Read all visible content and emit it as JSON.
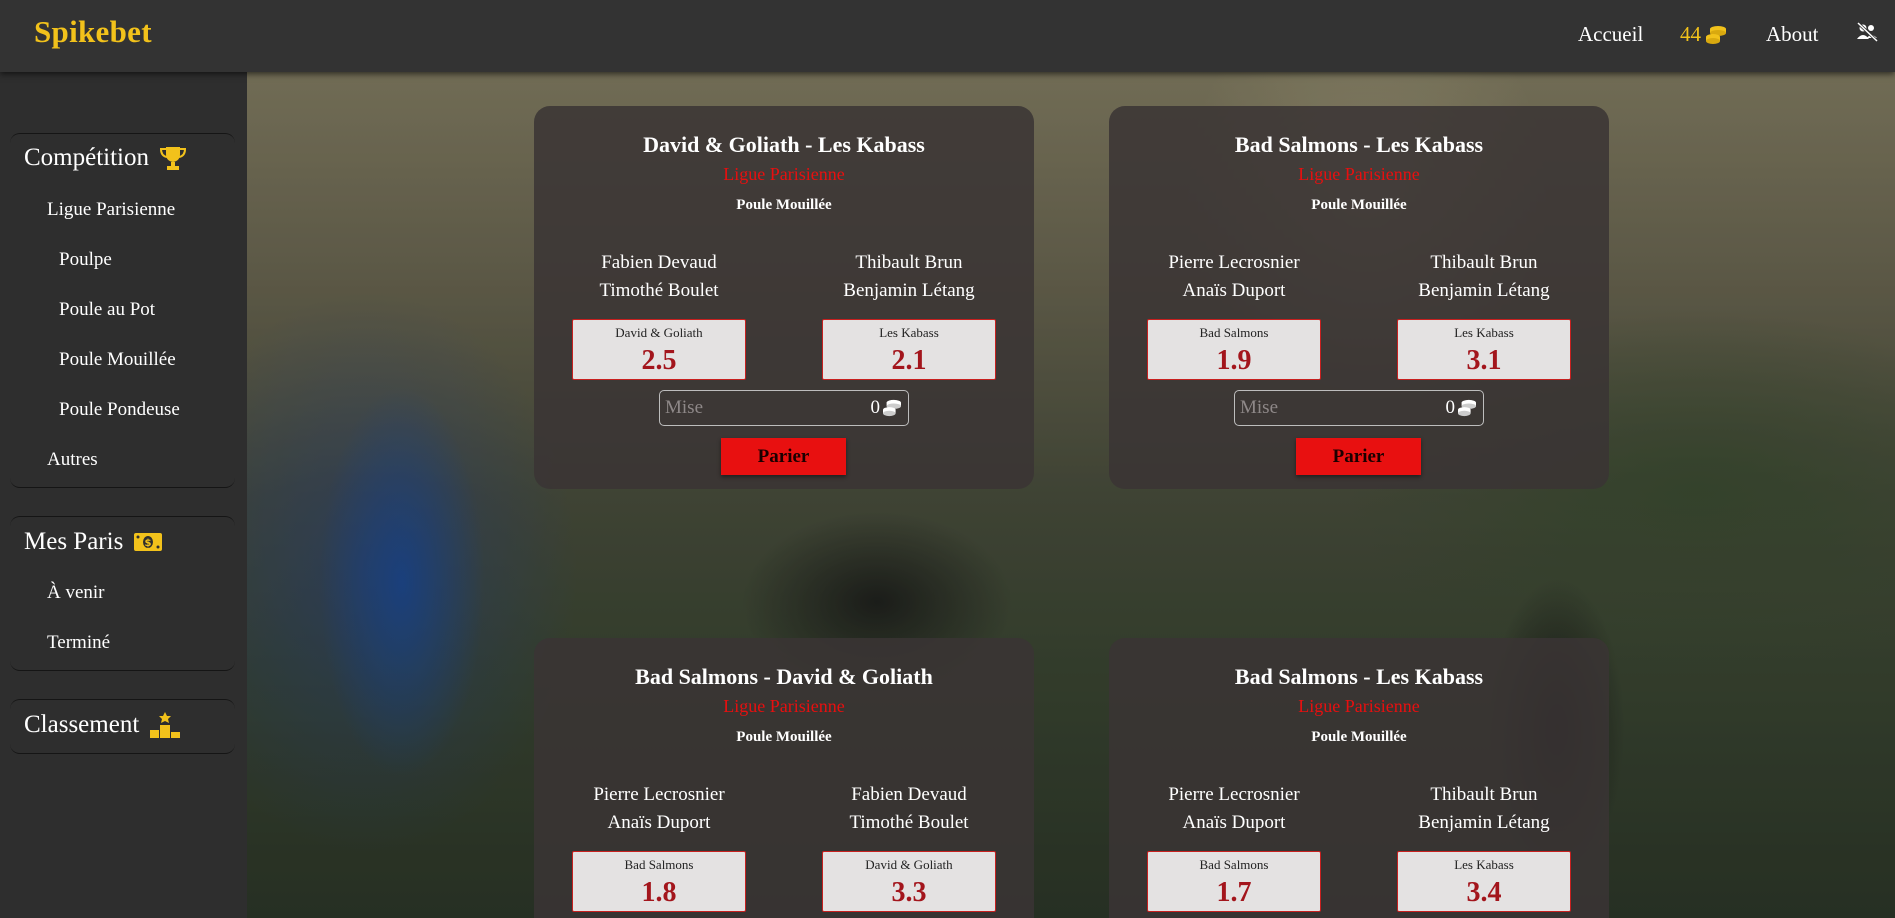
{
  "header": {
    "brand": "Spikebet",
    "nav_home": "Accueil",
    "coins": "44",
    "nav_about": "About",
    "user_icon": "users-slash-icon",
    "coin_icon": "coins-icon"
  },
  "sidebar": {
    "competition": {
      "title": "Compétition",
      "icon": "trophy-icon",
      "league": "Ligue Parisienne",
      "pools": [
        "Poulpe",
        "Poule au Pot",
        "Poule Mouillée",
        "Poule Pondeuse"
      ],
      "other": "Autres"
    },
    "bets": {
      "title": "Mes Paris",
      "icon": "money-bill-icon",
      "upcoming": "À venir",
      "finished": "Terminé"
    },
    "ranking": {
      "title": "Classement",
      "icon": "podium-icon"
    }
  },
  "matches": [
    {
      "title": "David & Goliath - Les Kabass",
      "league": "Ligue Parisienne",
      "pool": "Poule Mouillée",
      "team1_players": [
        "Fabien Devaud",
        "Timothé Boulet"
      ],
      "team2_players": [
        "Thibault Brun",
        "Benjamin Létang"
      ],
      "team1": "David & Goliath",
      "odd1": "2.5",
      "team2": "Les Kabass",
      "odd2": "2.1",
      "stake_placeholder": "Mise",
      "stake_amount": "0",
      "bet_label": "Parier"
    },
    {
      "title": "Bad Salmons - Les Kabass",
      "league": "Ligue Parisienne",
      "pool": "Poule Mouillée",
      "team1_players": [
        "Pierre Lecrosnier",
        "Anaïs Duport"
      ],
      "team2_players": [
        "Thibault Brun",
        "Benjamin Létang"
      ],
      "team1": "Bad Salmons",
      "odd1": "1.9",
      "team2": "Les Kabass",
      "odd2": "3.1",
      "stake_placeholder": "Mise",
      "stake_amount": "0",
      "bet_label": "Parier"
    },
    {
      "title": "Bad Salmons - David & Goliath",
      "league": "Ligue Parisienne",
      "pool": "Poule Mouillée",
      "team1_players": [
        "Pierre Lecrosnier",
        "Anaïs Duport"
      ],
      "team2_players": [
        "Fabien Devaud",
        "Timothé Boulet"
      ],
      "team1": "Bad Salmons",
      "odd1": "1.8",
      "team2": "David & Goliath",
      "odd2": "3.3"
    },
    {
      "title": "Bad Salmons - Les Kabass",
      "league": "Ligue Parisienne",
      "pool": "Poule Mouillée",
      "team1_players": [
        "Pierre Lecrosnier",
        "Anaïs Duport"
      ],
      "team2_players": [
        "Thibault Brun",
        "Benjamin Létang"
      ],
      "team1": "Bad Salmons",
      "odd1": "1.7",
      "team2": "Les Kabass",
      "odd2": "3.4"
    }
  ],
  "colors": {
    "brand_yellow": "#f2c21b",
    "league_red": "#e80f0f",
    "odd_red": "#a3151c",
    "button_red": "#e81010"
  }
}
